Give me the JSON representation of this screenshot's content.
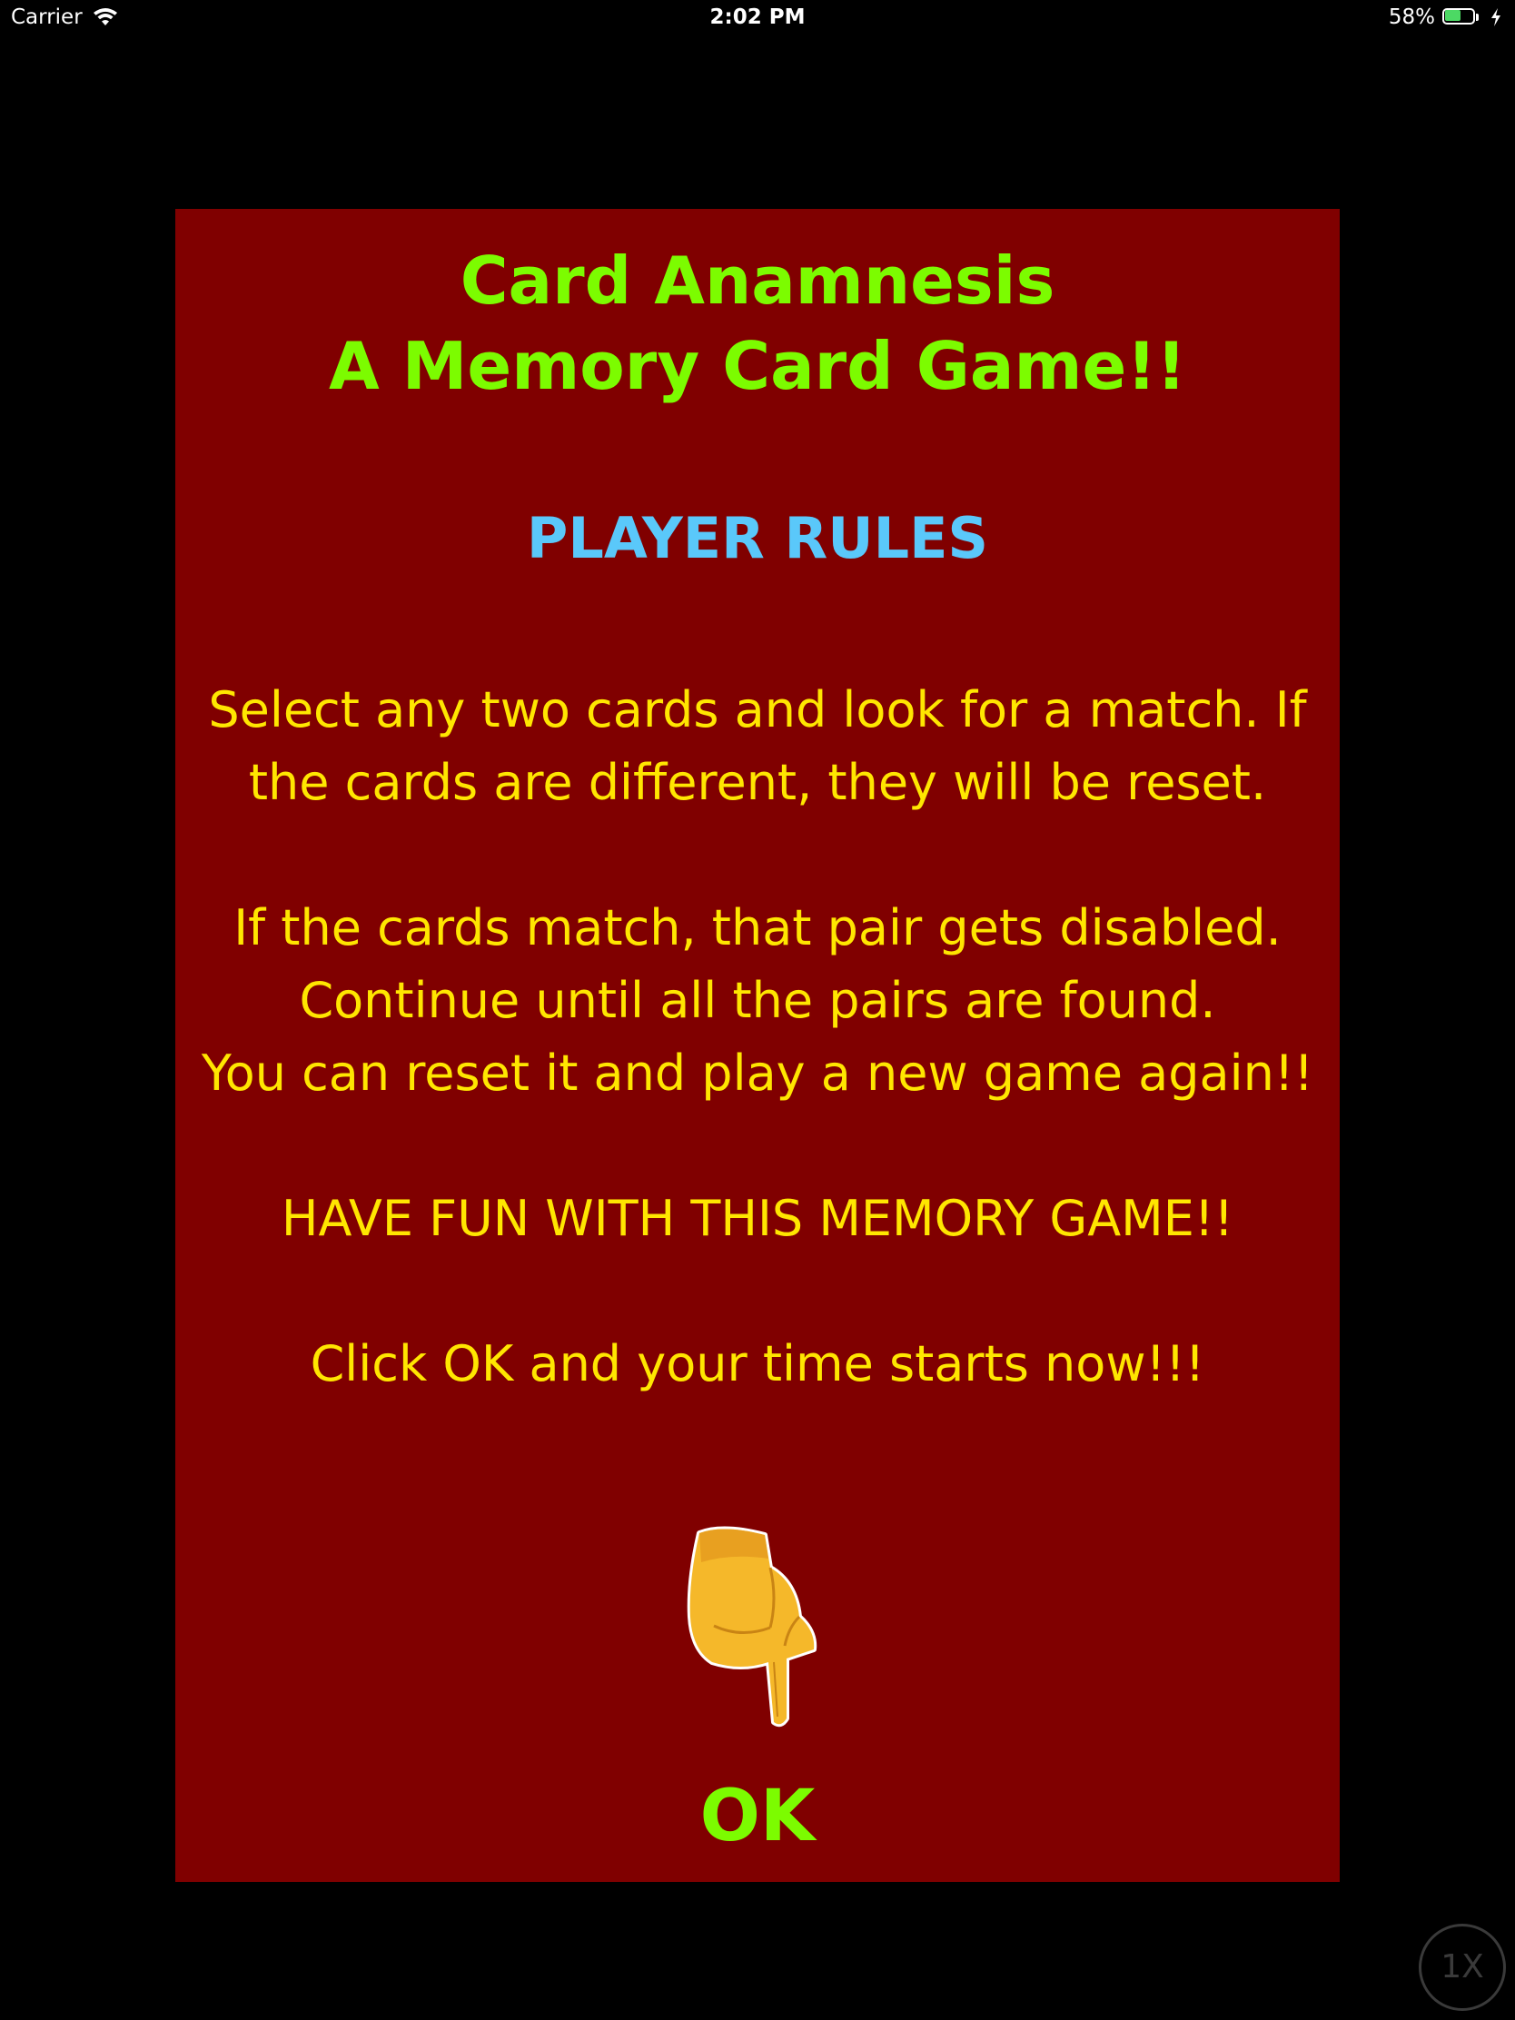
{
  "status_bar": {
    "carrier": "Carrier",
    "time": "2:02 PM",
    "battery_percent": "58%",
    "battery_level": 0.58,
    "icons": [
      "wifi-icon",
      "battery-icon",
      "charging-bolt-icon"
    ]
  },
  "dialog": {
    "background_color": "#800000",
    "title_line1": "Card Anamnesis",
    "title_line2": "A Memory Card Game!!",
    "title_color": "#7cfc00",
    "rules_heading": "PLAYER RULES",
    "rules_heading_color": "#5ac8fa",
    "text_color": "#ffe600",
    "paragraph1_line1": "Select any two cards and look for a match. If",
    "paragraph1_line2": "the cards are different, they will be reset.",
    "paragraph2_line1": "If the cards match, that pair gets disabled.",
    "paragraph2_line2": "Continue until all the pairs are found.",
    "paragraph2_line3": "You can reset it and play a new game again!!",
    "paragraph3": "HAVE FUN WITH THIS MEMORY GAME!!",
    "paragraph4": "Click OK and your time starts now!!!",
    "pointer_icon": "backhand-index-pointing-down-icon",
    "ok_label": "OK"
  },
  "speed_badge": "1X"
}
